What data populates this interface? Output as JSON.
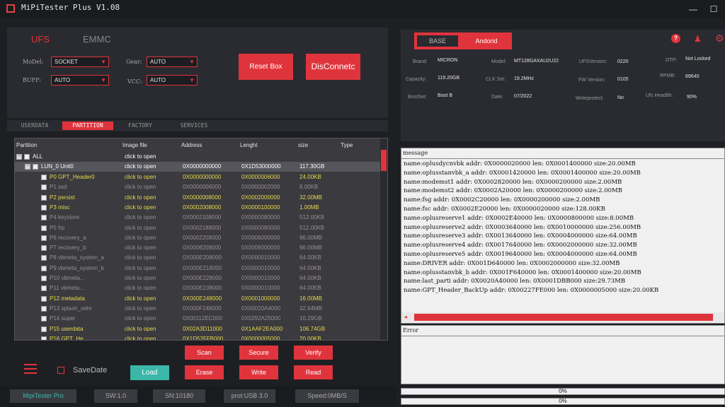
{
  "title": "MiPiTester Plus V1.08",
  "window_buttons": {
    "minimize": "—",
    "maximize": "☐",
    "close": "✕"
  },
  "tabs": {
    "ufs": "UFS",
    "emmc": "EMMC"
  },
  "settings": {
    "model_label": "MoDel:",
    "model_value": "SOCKET",
    "buff_label": "BUFF:",
    "buff_value": "AUTO",
    "gear_label": "Gear:",
    "gear_value": "AUTO",
    "vcc_label": "VCC:",
    "vcc_value": "AUTO",
    "reset_box": "Reset Box",
    "disconnect": "DisConnetc"
  },
  "subtabs": [
    "USERDATA",
    "PARTITION",
    "FACTORY",
    "SERVICES"
  ],
  "table": {
    "headers": [
      "Partition",
      "Image file",
      "Address",
      "Lenght",
      "size",
      "Type"
    ],
    "all_label": "ALL",
    "all_image": "click to open",
    "lun_label": "LUN_0 Unit0",
    "lun_image": "click to open",
    "lun_address": "0X0000000000",
    "lun_length": "0X1D53000000",
    "lun_size": "117.30GB",
    "rows": [
      {
        "name": "P0 GPT_Header0",
        "image": "click to open",
        "address": "0X0000000000",
        "length": "0X0000006000",
        "size": "24.00KB",
        "checked": true
      },
      {
        "name": "P1 ssd",
        "image": "click to open",
        "address": "0X0000006000",
        "length": "0X0000002000",
        "size": "8.00KB",
        "checked": false
      },
      {
        "name": "P2 persist",
        "image": "click to open",
        "address": "0X0000008000",
        "length": "0X0002000000",
        "size": "32.00MB",
        "checked": true
      },
      {
        "name": "P3 misc",
        "image": "click to open",
        "address": "0X0002008000",
        "length": "0X0000100000",
        "size": "1.00MB",
        "checked": true
      },
      {
        "name": "P4 keystore",
        "image": "click to open",
        "address": "0X0002108000",
        "length": "0X0000080000",
        "size": "512.00KB",
        "checked": false
      },
      {
        "name": "P5 frp",
        "image": "click to open",
        "address": "0X0002188000",
        "length": "0X0000080000",
        "size": "512.00KB",
        "checked": false
      },
      {
        "name": "P6 recovery_a",
        "image": "click to open",
        "address": "0X0002208000",
        "length": "0X0006000000",
        "size": "96.00MB",
        "checked": false
      },
      {
        "name": "P7 recovery_b",
        "image": "click to open",
        "address": "0X0008208000",
        "length": "0X0006000000",
        "size": "96.00MB",
        "checked": false
      },
      {
        "name": "P8 vbmeta_system_a",
        "image": "click to open",
        "address": "0X000E208000",
        "length": "0X0000010000",
        "size": "64.00KB",
        "checked": false
      },
      {
        "name": "P9 vbmeta_system_b",
        "image": "click to open",
        "address": "0X000E218000",
        "length": "0X0000010000",
        "size": "64.00KB",
        "checked": false
      },
      {
        "name": "P10 vbmeta...",
        "image": "click to open",
        "address": "0X000E228000",
        "length": "0X0000010000",
        "size": "64.00KB",
        "checked": false
      },
      {
        "name": "P11 vbmeta...",
        "image": "click to open",
        "address": "0X000E238000",
        "length": "0X0000010000",
        "size": "64.00KB",
        "checked": false
      },
      {
        "name": "P12 metadata",
        "image": "click to open",
        "address": "0X000E248000",
        "length": "0X0001000000",
        "size": "16.00MB",
        "checked": true
      },
      {
        "name": "P13 splash_odm",
        "image": "click to open",
        "address": "0X000F248000",
        "length": "0X00020A4000",
        "size": "32.64MB",
        "checked": false
      },
      {
        "name": "P14 super",
        "image": "click to open",
        "address": "0X00112EC000",
        "length": "0X0292A25000",
        "size": "10.29GB",
        "checked": false
      },
      {
        "name": "P15 userdata",
        "image": "click to open",
        "address": "0X02A3D11000",
        "length": "0X1AAF2EA000",
        "size": "106.74GB",
        "checked": true
      },
      {
        "name": "P16 GPT_He...",
        "image": "click to open",
        "address": "0X1D52FFB000",
        "length": "0X0000005000",
        "size": "20.00KB",
        "checked": true
      }
    ]
  },
  "buttons": {
    "scan": "Scan",
    "secure": "Secure",
    "verify": "Verify",
    "erase": "Erase",
    "write": "Write",
    "read": "Read",
    "load": "Load",
    "savedate": "SaveDate"
  },
  "status": {
    "product": "MipiTester Pro",
    "sw": "SW:1.0",
    "sn": "SN:10180",
    "prot": "prot:USB 3.0",
    "speed": "Speed:0MB/S"
  },
  "info_tabs": {
    "base": "BASE",
    "android": "Andorid"
  },
  "info": {
    "brand_k": "Brand:",
    "brand_v": "MICRON",
    "model_k": "Model:",
    "model_v": "MT128GAXAU2U22",
    "ufsver_k": "UFSVersion:",
    "ufsver_v": "0220",
    "otp_k": "OTP:",
    "otp_v": "Not Locked",
    "cap_k": "Capacity:",
    "cap_v": "119.20GB",
    "clk_k": "CLK Set:",
    "clk_v": "19.2MHz",
    "fw_k": "FW Version:",
    "fw_v": "0105",
    "rpmb_k": "RPMB:",
    "rpmb_v": "69640",
    "boot_k": "BootSet:",
    "boot_v": "Boot B",
    "date_k": "Date:",
    "date_v": "07/2022",
    "wp_k": "Writeprotect:",
    "wp_v": "No",
    "health_k": "Ufs Headlth:",
    "health_v": "90%"
  },
  "message": {
    "title": "message",
    "lines": [
      "name:oplusdycnvbk addr: 0X0000020000  len: 0X0001400000  size:20.00MB",
      "name:oplusstanvbk_a addr: 0X0001420000  len: 0X0001400000  size:20.00MB",
      "name:modemst1 addr: 0X0002820000  len: 0X0000200000  size:2.00MB",
      "name:modemst2 addr: 0X0002A20000  len: 0X0000200000  size:2.00MB",
      "name:fsg addr: 0X0002C20000  len: 0X0000200000  size:2.00MB",
      "name:fsc addr: 0X0002E20000  len: 0X0000020000  size:128.00KB",
      "name:oplusreserve1 addr: 0X0002E40000  len: 0X0000800000  size:8.00MB",
      "name:oplusreserve2 addr: 0X0003640000  len: 0X0010000000  size:256.00MB",
      "name:oplusreserve3 addr: 0X0013640000  len: 0X0004000000  size:64.00MB",
      "name:oplusreserve4 addr: 0X0017640000  len: 0X0002000000  size:32.00MB",
      "name:oplusreserve5 addr: 0X0019640000  len: 0X0004000000  size:64.00MB",
      "name:DRIVER addr: 0X001D640000  len: 0X0002000000  size:32.00MB",
      "name:oplusstanvbk_b addr: 0X001F640000  len: 0X0001400000  size:20.00MB",
      "name:last_parti addr: 0X0020A40000  len: 0X0001DBB000  size:29.73MB",
      "name:GPT_Header_BackUp addr: 0X00227FE000  len: 0X0000005000  size:20.00KB"
    ]
  },
  "error": {
    "title": "Error"
  },
  "progress": [
    {
      "label": "0%",
      "value": 0
    },
    {
      "label": "0%",
      "value": 0
    }
  ],
  "colors": {
    "accent": "#e0343d",
    "load": "#3bb7a8",
    "checked_text": "#e8d94a",
    "unchecked_text": "#9a8f8f"
  }
}
